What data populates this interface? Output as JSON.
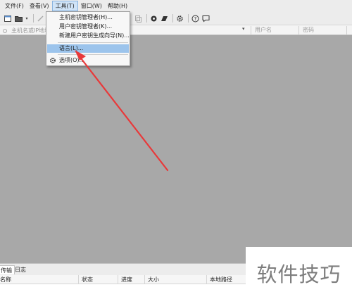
{
  "menubar": {
    "items": [
      {
        "label": "文件(F)"
      },
      {
        "label": "查看(V)"
      },
      {
        "label": "工具(T)",
        "active": true
      },
      {
        "label": "窗口(W)"
      },
      {
        "label": "帮助(H)"
      }
    ]
  },
  "toolbar": {
    "icons": [
      "new-session-icon",
      "open-folder-icon",
      "dropdown-arrow-icon",
      "reconnect-icon",
      "copy-icon",
      "sftp-icon",
      "agent-icon",
      "settings-gear-icon",
      "help-icon",
      "chat-icon"
    ]
  },
  "hostbar": {
    "host_placeholder": "主机名或IP地址",
    "user_placeholder": "用户名",
    "password_placeholder": "密码"
  },
  "tools_menu": {
    "items": [
      {
        "label": "主机密钥管理者(H)..."
      },
      {
        "label": "用户密钥管理者(K)..."
      },
      {
        "label": "新建用户密钥生成向导(N)..."
      },
      {
        "label": "语言(L)...",
        "highlighted": true
      },
      {
        "label": "选项(O)..."
      }
    ]
  },
  "bottom_panel": {
    "tabs": [
      {
        "label": "传输",
        "active": true
      },
      {
        "label": "日志"
      }
    ],
    "columns": [
      "名称",
      "状态",
      "进度",
      "大小",
      "本地路径"
    ]
  },
  "watermark": {
    "text": "软件技巧"
  },
  "colors": {
    "menu_highlight": "#9cc4ec",
    "workspace": "#a8a8a8",
    "annotation_arrow": "#e8393a"
  }
}
